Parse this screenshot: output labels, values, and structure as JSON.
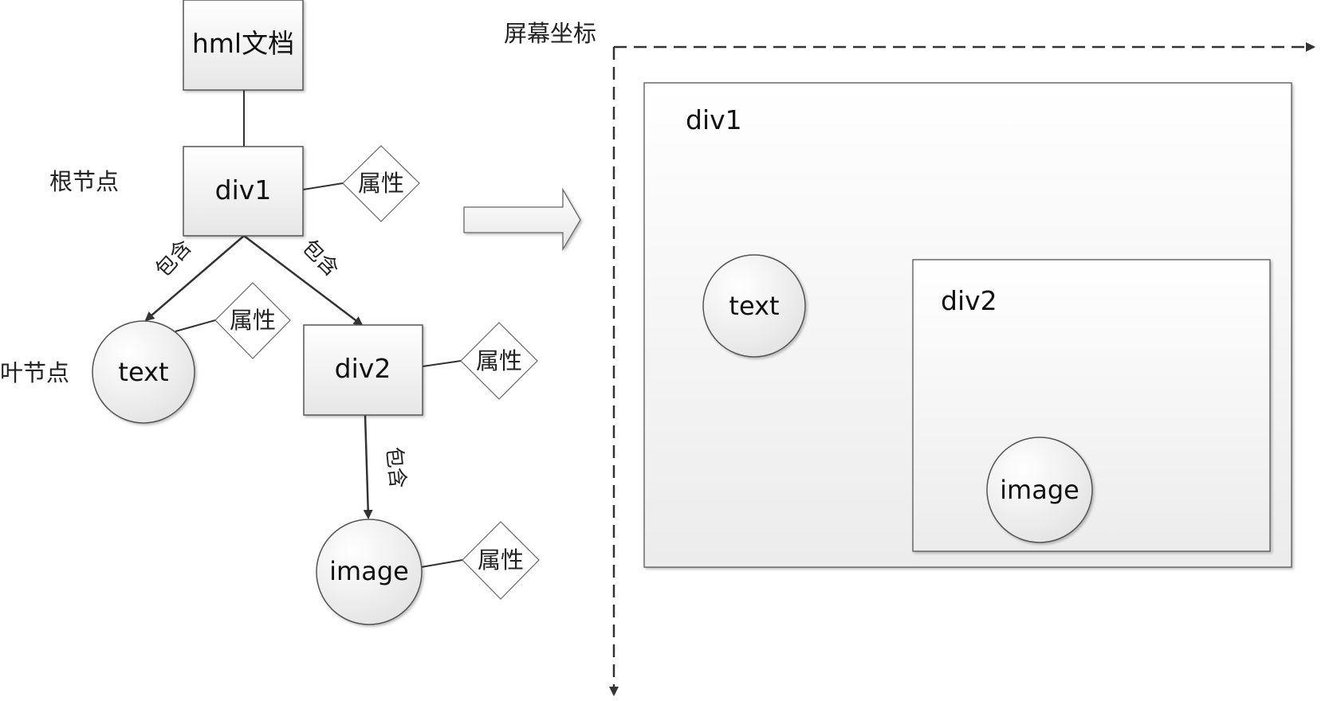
{
  "tree": {
    "root_doc": "hml文档",
    "root_label": "根节点",
    "leaf_label": "叶节点",
    "div1": "div1",
    "text": "text",
    "div2": "div2",
    "image": "image",
    "attr": "属性",
    "contains": "包含"
  },
  "screen": {
    "axis_label": "屏幕坐标",
    "div1": "div1",
    "div2": "div2",
    "text": "text",
    "image": "image"
  }
}
